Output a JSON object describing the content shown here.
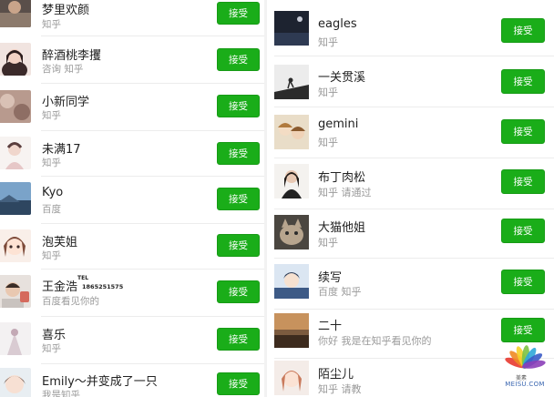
{
  "left_list": {
    "items": [
      {
        "name": "梦里欢颜",
        "subtitle": "知乎",
        "button": "接受",
        "avatar": "avatar-photo-icon"
      },
      {
        "name": "醉酒桃李攫",
        "subtitle": "咨询 知乎",
        "button": "接受",
        "avatar": "avatar-girl-photo-icon"
      },
      {
        "name": "小新同学",
        "subtitle": "知乎",
        "button": "接受",
        "avatar": "avatar-blurred-photo-icon"
      },
      {
        "name": "未满17",
        "subtitle": "知乎",
        "button": "接受",
        "avatar": "avatar-illustration-icon"
      },
      {
        "name": "Kyo",
        "subtitle": "百度",
        "button": "接受",
        "avatar": "avatar-landscape-icon"
      },
      {
        "name": "泡芙姐",
        "subtitle": "知乎",
        "button": "接受",
        "avatar": "avatar-anime-girl-icon"
      },
      {
        "name": "王金浩",
        "subtitle": "百度看见你的",
        "button": "接受",
        "avatar": "avatar-boy-photo-icon",
        "phone_label": "TEL",
        "phone": "1865251575"
      },
      {
        "name": "喜乐",
        "subtitle": "知乎",
        "button": "接受",
        "avatar": "avatar-light-illustration-icon"
      },
      {
        "name": "Emily～并变成了一只",
        "subtitle": "我是知乎",
        "button": "接受",
        "avatar": "avatar-anime-icon"
      }
    ]
  },
  "right_list": {
    "items": [
      {
        "name": "eagles",
        "subtitle": "知乎",
        "button": "接受",
        "avatar": "avatar-night-photo-icon"
      },
      {
        "name": "一关贯溪",
        "subtitle": "知乎",
        "button": "接受",
        "avatar": "avatar-silhouette-icon"
      },
      {
        "name": "gemini",
        "subtitle": "知乎",
        "button": "接受",
        "avatar": "avatar-anime-pair-icon"
      },
      {
        "name": "布丁肉松",
        "subtitle": "知乎 请通过",
        "button": "接受",
        "avatar": "avatar-girl-photo-icon"
      },
      {
        "name": "大猫他姐",
        "subtitle": "知乎",
        "button": "接受",
        "avatar": "avatar-cat-icon"
      },
      {
        "name": "续写",
        "subtitle": "百度 知乎",
        "button": "接受",
        "avatar": "avatar-anime-boy-icon"
      },
      {
        "name": "二十",
        "subtitle": "你好 我是在知乎看见你的",
        "button": "接受",
        "avatar": "avatar-sunset-photo-icon"
      },
      {
        "name": "陌尘儿",
        "subtitle": "知乎 请教",
        "button": "接受",
        "avatar": "avatar-anime-girl-icon"
      }
    ]
  },
  "watermark": {
    "text": "MEISU.COM",
    "cn": "美素",
    "icon": "flower-logo-icon"
  },
  "colors": {
    "accept_button": "#1aad19",
    "title_text": "#222222",
    "subtitle_text": "#9a9a9a"
  }
}
